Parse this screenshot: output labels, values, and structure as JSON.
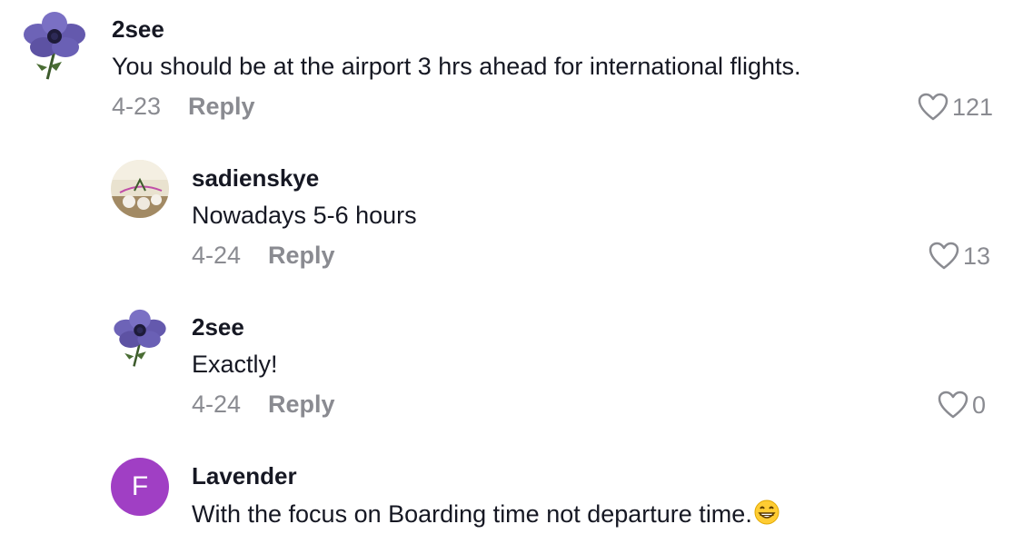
{
  "comments": [
    {
      "username": "2see",
      "text": "You should be at the airport 3 hrs ahead for international flights.",
      "date": "4-23",
      "reply_label": "Reply",
      "likes": "121",
      "avatar_icon": "purple-anemone-flower"
    },
    {
      "username": "sadienskye",
      "text": "Nowadays 5-6 hours",
      "date": "4-24",
      "reply_label": "Reply",
      "likes": "13",
      "avatar_icon": "sadienskye-photo"
    },
    {
      "username": "2see",
      "text": "Exactly!",
      "date": "4-24",
      "reply_label": "Reply",
      "likes": "0",
      "avatar_icon": "purple-anemone-flower"
    },
    {
      "username": "Lavender",
      "text": "With the focus on Boarding time not departure time.",
      "emoji": "😁",
      "avatar_letter": "F",
      "avatar_color": "#a03fc4"
    }
  ],
  "colors": {
    "text": "#161823",
    "muted": "#8a8b91",
    "heart_outline": "#8a8b91"
  }
}
